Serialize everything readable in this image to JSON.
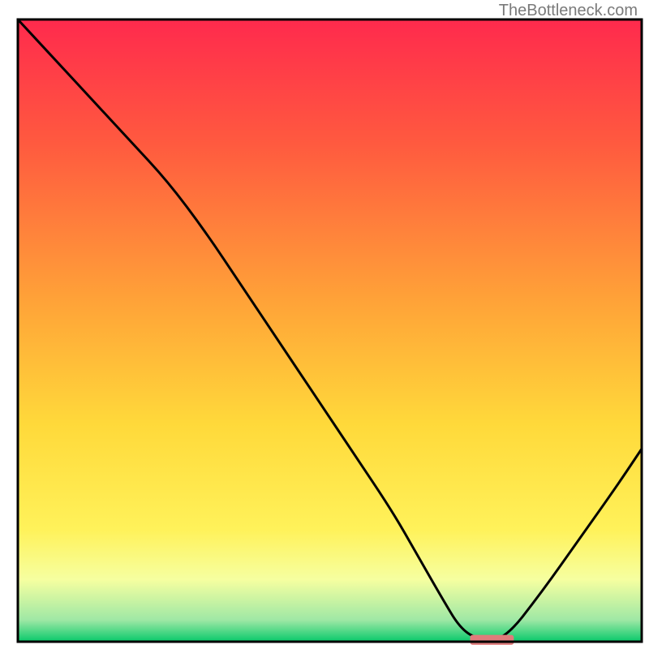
{
  "watermark": "TheBottleneck.com",
  "chart_data": {
    "type": "line",
    "title": "",
    "xlabel": "",
    "ylabel": "",
    "xlim": [
      0,
      100
    ],
    "ylim": [
      0,
      100
    ],
    "axes_visible": false,
    "grid": false,
    "background": {
      "type": "vertical-gradient",
      "stops": [
        {
          "offset": 0.0,
          "color": "#ff2a4d"
        },
        {
          "offset": 0.2,
          "color": "#ff5a3f"
        },
        {
          "offset": 0.45,
          "color": "#ffa238"
        },
        {
          "offset": 0.65,
          "color": "#ffd93a"
        },
        {
          "offset": 0.82,
          "color": "#fff25a"
        },
        {
          "offset": 0.9,
          "color": "#f6ffa0"
        },
        {
          "offset": 0.965,
          "color": "#9fe8a5"
        },
        {
          "offset": 1.0,
          "color": "#08c96b"
        }
      ]
    },
    "series": [
      {
        "name": "bottleneck-curve",
        "color": "#000000",
        "stroke_width": 3,
        "x": [
          0.0,
          6.0,
          12.0,
          18.0,
          24.0,
          30.0,
          36.0,
          42.0,
          48.0,
          54.0,
          60.0,
          64.0,
          68.0,
          71.0,
          74.0,
          78.0,
          84.0,
          90.0,
          96.0,
          100.0
        ],
        "values": [
          100.0,
          93.5,
          87.0,
          80.5,
          74.0,
          66.0,
          57.0,
          48.0,
          39.0,
          30.0,
          21.0,
          14.0,
          7.0,
          2.0,
          0.3,
          0.3,
          8.0,
          16.5,
          25.0,
          31.0
        ]
      }
    ],
    "marker": {
      "name": "optimal-point",
      "x_center": 76.0,
      "y_center": 0.3,
      "width": 7.0,
      "height": 1.6,
      "color": "#e07b7b",
      "corner_radius": 3
    },
    "frame": {
      "color": "#000000",
      "stroke_width": 3
    }
  }
}
